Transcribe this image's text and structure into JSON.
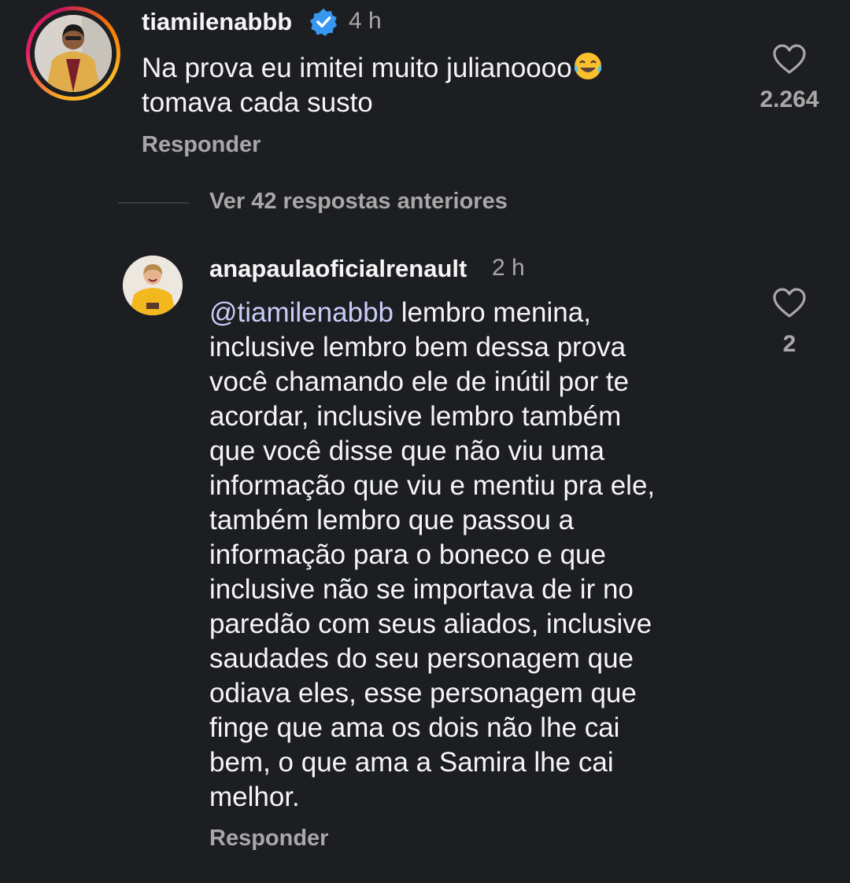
{
  "comment1": {
    "username": "tiamilenabbb",
    "verified": true,
    "time": "4 h",
    "text_line1": "Na prova eu imitei muito julianoooo",
    "emoji": "face-with-tears-of-joy",
    "text_line2": "tomava cada susto",
    "likes": "2.264",
    "reply_label": "Responder",
    "avatar_ring_color": "#e91e63"
  },
  "view_replies_label": "Ver 42 respostas anteriores",
  "comment2": {
    "username": "anapaulaoficialrenault",
    "time": "2 h",
    "mention": "@tiamilenabbb",
    "text": " lembro menina,\ninclusive lembro bem dessa prova\nvocê chamando ele de inútil por te\nacordar, inclusive lembro também\nque você disse que não viu uma\ninformação que viu e mentiu pra ele,\ntambém lembro que passou a\ninformação para o boneco e que\ninclusive não se importava de ir no\nparedão com seus aliados, inclusive\nsaudades do seu personagem que\nodiava eles, esse personagem que\nfinge que ama os dois não lhe cai\nbem, o que ama a Samira lhe cai\nmelhor.",
    "likes": "2",
    "reply_label": "Responder"
  },
  "colors": {
    "background": "#1c1e22",
    "text_primary": "#f5f5f5",
    "text_secondary": "#a8a8a8",
    "mention": "#c9cdf7",
    "verified_badge": "#3897f0"
  }
}
